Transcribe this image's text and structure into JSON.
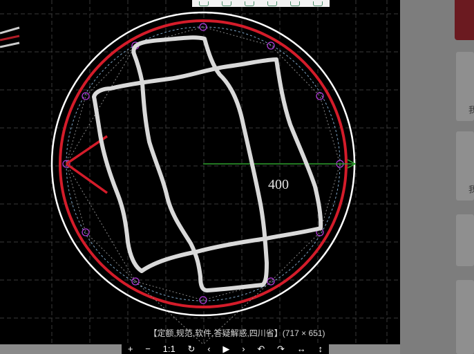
{
  "viewer": {
    "caption": "【定额,规范,软件,答疑解惑,四川省】(717 × 651)",
    "dimension_label": "400",
    "controls": [
      {
        "name": "zoom-in-button",
        "label": "+"
      },
      {
        "name": "zoom-out-button",
        "label": "−"
      },
      {
        "name": "actual-size-button",
        "label": "1:1"
      },
      {
        "name": "reset-button",
        "label": "↻"
      },
      {
        "name": "prev-button",
        "label": "‹"
      },
      {
        "name": "play-button",
        "label": "▶"
      },
      {
        "name": "next-button",
        "label": "›"
      },
      {
        "name": "rotate-left-button",
        "label": "↶"
      },
      {
        "name": "rotate-right-button",
        "label": "↷"
      },
      {
        "name": "flip-horizontal-button",
        "label": "↔"
      },
      {
        "name": "flip-vertical-button",
        "label": "↕"
      }
    ],
    "toolbar_icons": [
      "search-icon",
      "document-icon",
      "fullscreen-icon",
      "share-icon",
      "image-icon",
      "settings-icon"
    ]
  },
  "side_panel": {
    "card_text_1": "我",
    "card_text_2": "我"
  },
  "colors": {
    "background": "#000000",
    "grid": "#3a3a3a",
    "ring_white": "#ffffff",
    "ring_red": "#d41c2a",
    "handwriting": "#d9d9d9",
    "dimension_arrow": "#2fa12f",
    "vertex_markers": "#b13bd6"
  }
}
